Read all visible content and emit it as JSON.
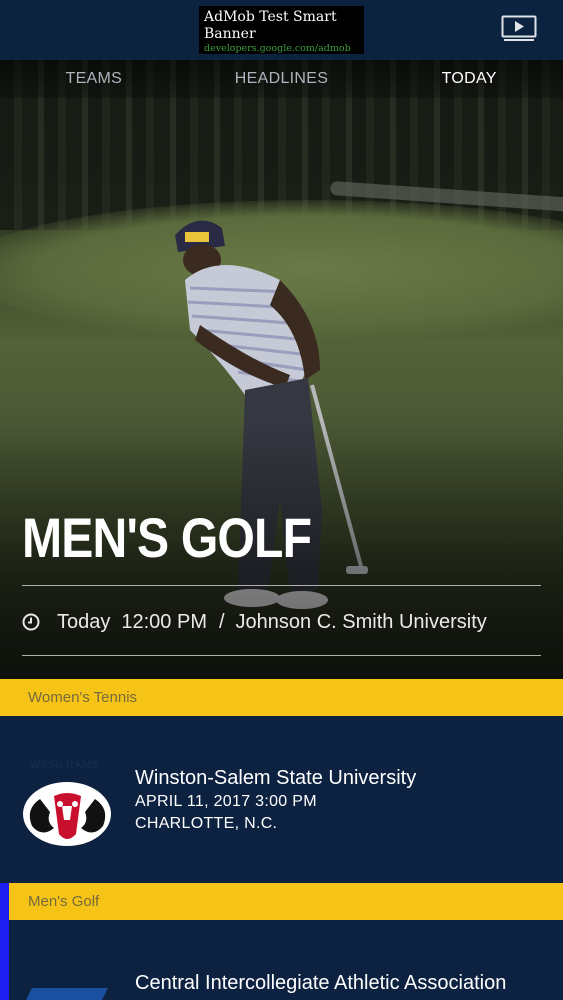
{
  "ad": {
    "title": "AdMob Test Smart Banner",
    "url": "developers.google.com/admob"
  },
  "icons": {
    "cast": "tv-play-icon",
    "clock": "clock-icon"
  },
  "tabs": [
    {
      "label": "TEAMS",
      "active": false
    },
    {
      "label": "HEADLINES",
      "active": false
    },
    {
      "label": "TODAY",
      "active": true
    }
  ],
  "featured": {
    "title": "MEN'S GOLF",
    "day": "Today",
    "time": "12:00 PM",
    "separator": "/",
    "location": "Johnson C. Smith University"
  },
  "events": [
    {
      "sport": "Women's Tennis",
      "opponent": "Winston-Salem State University",
      "date_time": "APRIL 11, 2017  3:00 PM",
      "place": "CHARLOTTE, N.C."
    },
    {
      "sport": "Men's Golf",
      "opponent": "Central Intercollegiate Athletic Association",
      "date_time": "",
      "place": ""
    }
  ],
  "colors": {
    "navy": "#0d2240",
    "gold": "#f6c416",
    "accent_blue": "#1d1ff0"
  }
}
